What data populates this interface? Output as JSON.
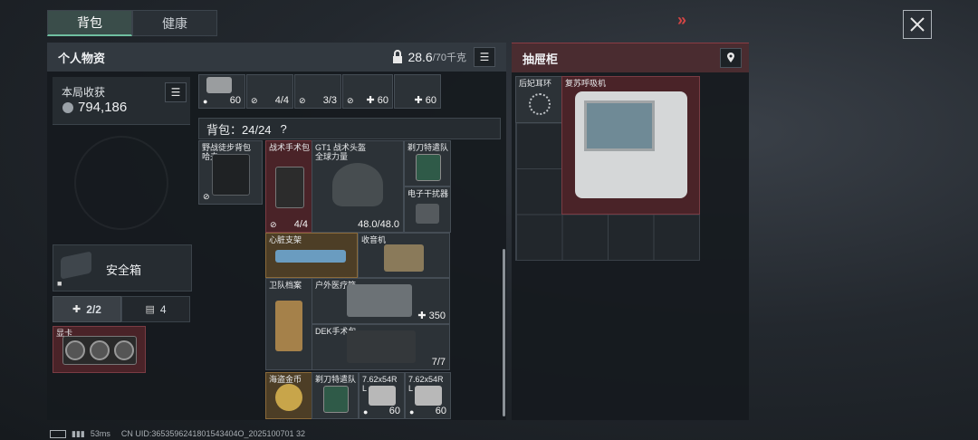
{
  "tabs": {
    "backpack": "背包",
    "health": "健康"
  },
  "nav_forward": "»",
  "left_panel": {
    "title": "个人物资",
    "weight": "28.6",
    "weight_max": "/70千克",
    "earnings": {
      "label": "本局收获",
      "value": "794,186"
    },
    "safebox": {
      "label": "安全箱"
    },
    "counters": {
      "a": "2/2",
      "b": "4"
    },
    "gpu_slot": {
      "label": "显卡"
    }
  },
  "top_row": [
    {
      "qty": "60"
    },
    {
      "qty": "4/4"
    },
    {
      "qty": "3/3"
    },
    {
      "qty": "60"
    },
    {
      "qty": "60"
    }
  ],
  "backpack": {
    "title": "背包：24/24",
    "help": "?",
    "bag_name": "野战徒步背包",
    "bag_sub": "哈夫",
    "items": {
      "tactical_pack": {
        "name": "战术手术包",
        "qty": "4/4"
      },
      "helmet": {
        "name": "GT1 战术头盔",
        "sub": "全球力量",
        "qty": "48.0/48.0"
      },
      "special_team_1": {
        "name": "剃刀特遣队"
      },
      "jammer": {
        "name": "电子干扰器"
      },
      "heart_stand": {
        "name": "心脏支架"
      },
      "radio": {
        "name": "收音机"
      },
      "guard_file": {
        "name": "卫队档案"
      },
      "outdoor_med": {
        "name": "户外医疗箱",
        "qty": "350"
      },
      "dek_pack": {
        "name": "DEK手术包",
        "qty": "7/7"
      },
      "pirate_coin": {
        "name": "海盗金币"
      },
      "special_team_2": {
        "name": "剃刀特遣队"
      },
      "ammo_1": {
        "name": "7.62x54R",
        "sub": "L",
        "qty": "60"
      },
      "ammo_2": {
        "name": "7.62x54R",
        "sub": "L",
        "qty": "60"
      }
    }
  },
  "drawer": {
    "title": "抽屉柜",
    "items": {
      "earring": {
        "name": "后妃耳环"
      },
      "resuscitator": {
        "name": "复苏呼吸机"
      }
    }
  },
  "status_bar": {
    "ping": "53ms",
    "uid": "CN UID:3653596241801543404O_2025100701 32"
  }
}
